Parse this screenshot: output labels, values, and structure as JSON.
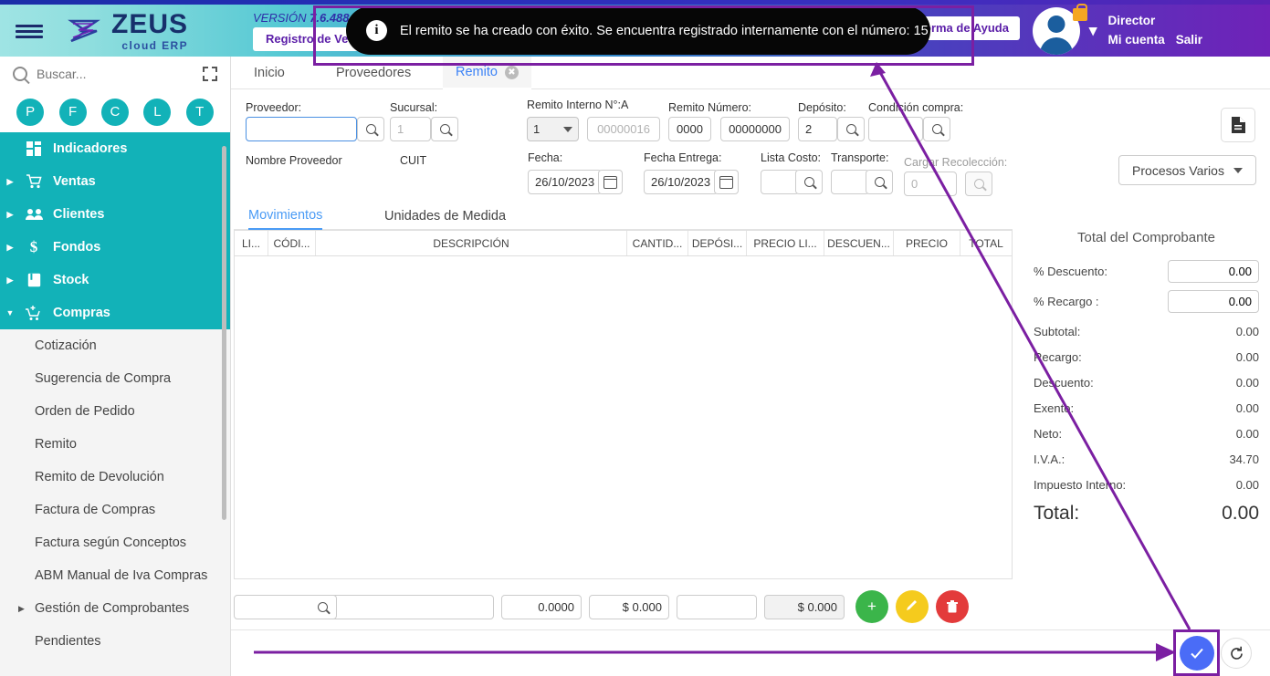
{
  "header": {
    "version_prefix": "VERSIÓN",
    "version_number": "7.6.488.1",
    "logo_title": "ZEUS",
    "logo_sub": "cloud ERP",
    "registro_button": "Registro de Ve",
    "help_button": "orma de Ayuda",
    "user_name": "Director",
    "my_account": "Mi cuenta",
    "logout": "Salir"
  },
  "toast": {
    "icon": "info-icon",
    "message": "El remito se ha creado con éxito. Se encuentra registrado internamente con el número: 15"
  },
  "sidebar": {
    "search_placeholder": "Buscar...",
    "shortcuts": [
      "P",
      "F",
      "C",
      "L",
      "T"
    ],
    "menu": [
      {
        "label": "Indicadores",
        "icon": "dashboard-icon",
        "expandable": false,
        "expanded": false
      },
      {
        "label": "Ventas",
        "icon": "cart-icon",
        "expandable": true,
        "expanded": false
      },
      {
        "label": "Clientes",
        "icon": "people-icon",
        "expandable": true,
        "expanded": false
      },
      {
        "label": "Fondos",
        "icon": "dollar-icon",
        "expandable": true,
        "expanded": false
      },
      {
        "label": "Stock",
        "icon": "box-icon",
        "expandable": true,
        "expanded": false
      },
      {
        "label": "Compras",
        "icon": "cart-plus-icon",
        "expandable": true,
        "expanded": true
      }
    ],
    "submenu": [
      {
        "label": "Cotización",
        "expandable": false
      },
      {
        "label": "Sugerencia de Compra",
        "expandable": false
      },
      {
        "label": "Orden de Pedido",
        "expandable": false
      },
      {
        "label": "Remito",
        "expandable": false
      },
      {
        "label": "Remito de Devolución",
        "expandable": false
      },
      {
        "label": "Factura de Compras",
        "expandable": false
      },
      {
        "label": "Factura según Conceptos",
        "expandable": false
      },
      {
        "label": "ABM Manual de Iva Compras",
        "expandable": false
      },
      {
        "label": "Gestión de Comprobantes",
        "expandable": true
      },
      {
        "label": "Pendientes",
        "expandable": false
      }
    ]
  },
  "tabs": [
    {
      "label": "Inicio",
      "active": false,
      "closable": false
    },
    {
      "label": "Proveedores",
      "active": false,
      "closable": false
    },
    {
      "label": "Remito",
      "active": true,
      "closable": true
    }
  ],
  "form": {
    "proveedor_label": "Proveedor:",
    "proveedor_value": "",
    "sucursal_label": "Sucursal:",
    "sucursal_value": "1",
    "nombre_proveedor_label": "Nombre Proveedor",
    "cuit_label": "CUIT",
    "remito_interno_label": "Remito Interno N°:A",
    "remito_interno_select": "1",
    "remito_interno_value": "00000016",
    "remito_numero_label": "Remito Número:",
    "remito_numero_a": "0000",
    "remito_numero_b": "00000000",
    "deposito_label": "Depósito:",
    "deposito_value": "2",
    "condicion_compra_label": "Condición compra:",
    "condicion_compra_value": "",
    "fecha_label": "Fecha:",
    "fecha_value": "26/10/2023",
    "fecha_entrega_label": "Fecha Entrega:",
    "fecha_entrega_value": "26/10/2023",
    "lista_costo_label": "Lista Costo:",
    "lista_costo_value": "",
    "transporte_label": "Transporte:",
    "transporte_value": "",
    "cargar_recoleccion_label": "Cargar Recolección:",
    "cargar_recoleccion_value": "0"
  },
  "actions": {
    "document_icon": "document-icon",
    "procesos_varios": "Procesos Varios"
  },
  "inner_tabs": [
    {
      "label": "Movimientos",
      "active": true
    },
    {
      "label": "Unidades de Medida",
      "active": false
    }
  ],
  "grid": {
    "columns": [
      "LI...",
      "CÓDI...",
      "DESCRIPCIÓN",
      "CANTID...",
      "DEPÓSI...",
      "PRECIO LI...",
      "DESCUEN...",
      "PRECIO",
      "TOTAL"
    ],
    "rows": []
  },
  "row_editor": {
    "codigo_value": "",
    "descripcion_value": "",
    "cantidad_value": "0.0000",
    "precio_lista_value": "$ 0.000",
    "descuento_value": "",
    "precio_value": "$ 0.000",
    "add_button": "+",
    "edit_button": "edit-icon",
    "delete_button": "trash-icon"
  },
  "totals": {
    "title": "Total del Comprobante",
    "rows": [
      {
        "label": "% Descuento:",
        "value": "0.00",
        "input": true
      },
      {
        "label": "% Recargo :",
        "value": "0.00",
        "input": true
      },
      {
        "label": "Subtotal:",
        "value": "0.00",
        "input": false
      },
      {
        "label": "Recargo:",
        "value": "0.00",
        "input": false
      },
      {
        "label": "Descuento:",
        "value": "0.00",
        "input": false
      },
      {
        "label": "Exento:",
        "value": "0.00",
        "input": false
      },
      {
        "label": "Neto:",
        "value": "0.00",
        "input": false
      },
      {
        "label": "I.V.A.:",
        "value": "34.70",
        "input": false
      },
      {
        "label": "Impuesto Interno:",
        "value": "0.00",
        "input": false
      }
    ],
    "total_label": "Total:",
    "total_value": "0.00"
  },
  "footer": {
    "confirm_icon": "check-icon",
    "refresh_icon": "refresh-icon"
  },
  "colors": {
    "accent_teal": "#12b2b8",
    "accent_purple": "#7b1fa2",
    "confirm_blue": "#4a6cf7",
    "add_green": "#3bb54a",
    "edit_yellow": "#f5cb1d",
    "delete_red": "#e33b3b"
  }
}
